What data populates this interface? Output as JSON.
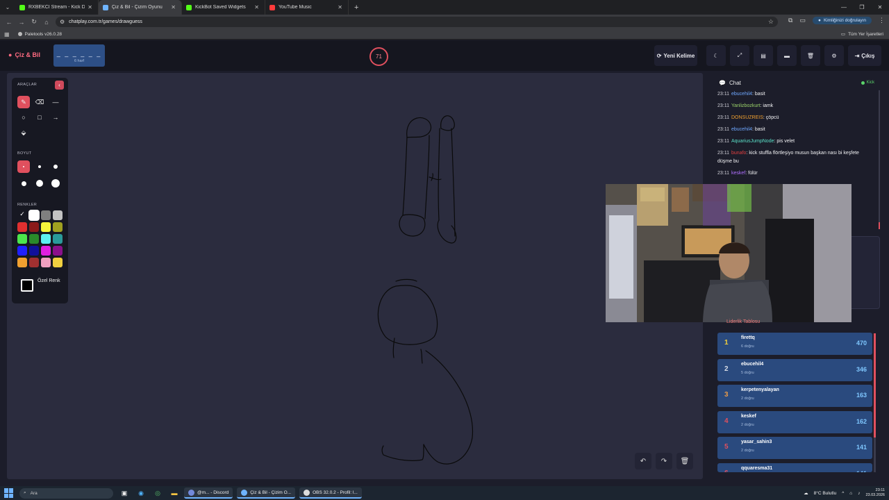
{
  "browser": {
    "tabs": [
      {
        "title": "RXBEKCI Stream - Kick Dashbo",
        "color": "#53fc18",
        "active": false
      },
      {
        "title": "Çiz & Bil - Çizim Oyunu",
        "color": "#6fb4ff",
        "active": true
      },
      {
        "title": "KickBot Saved Widgets",
        "color": "#53fc18",
        "active": false
      },
      {
        "title": "YouTube Music",
        "color": "#ff3b3b",
        "active": false
      }
    ],
    "url": "chatplay.com.tr/games/drawguess",
    "verify_label": "Kimliğinizi doğrulayın",
    "bookmark": "Paletools v26.0.28",
    "all_bookmarks": "Tüm Yer İşaretleri"
  },
  "header": {
    "logo": "Çiz & Bil",
    "word_mask": "_ _ _ _ _ _",
    "word_length": "6 harf",
    "timer": "71",
    "new_word": "Yeni Kelime",
    "exit": "Çıkış"
  },
  "tools": {
    "tools_label": "ARAÇLAR",
    "size_label": "BOYUT",
    "colors_label": "RENKLER",
    "custom_color": "Özel Renk",
    "palette": [
      "#000000",
      "#ffffff",
      "#7f7f7f",
      "#c3c3c3",
      "#e03030",
      "#8b1a1a",
      "#f5f53b",
      "#a0a020",
      "#4ce64c",
      "#2a8a2a",
      "#5cf0f0",
      "#2a9a9a",
      "#2020ff",
      "#10109a",
      "#e020e0",
      "#8a108a",
      "#f0a030",
      "#a03030",
      "#f0a0c0",
      "#f0d040"
    ]
  },
  "chat": {
    "title": "Chat",
    "source": "Kick",
    "messages": [
      {
        "time": "23:11",
        "user": "ebucehil4",
        "color": "#6fa8ff",
        "text": "basit"
      },
      {
        "time": "23:11",
        "user": "Yanlizbozkurt",
        "color": "#9bd36a",
        "text": "iamk"
      },
      {
        "time": "23:11",
        "user": "DONSUZREIS",
        "color": "#f0a030",
        "text": "çöpcü"
      },
      {
        "time": "23:11",
        "user": "ebucehil4",
        "color": "#6fa8ff",
        "text": "basit"
      },
      {
        "time": "23:11",
        "user": "AquariusJumpNode",
        "color": "#5be0c8",
        "text": "pis velet"
      },
      {
        "time": "23:11",
        "user": "bunafo",
        "color": "#e04040",
        "text": "kick stuffla flörtleşiyo musun başkan nası bi keşfete düşme bu"
      },
      {
        "time": "23:11",
        "user": "keskef",
        "color": "#b070ff",
        "text": "fülür"
      }
    ]
  },
  "leaderboard": {
    "title": "Liderlik Tablosu",
    "rows": [
      {
        "rank": "1",
        "name": "firettq",
        "sub": "6 doğru",
        "score": "470",
        "rank_color": "#f5d23b"
      },
      {
        "rank": "2",
        "name": "ebucehil4",
        "sub": "5 doğru",
        "score": "346",
        "rank_color": "#d8dde6"
      },
      {
        "rank": "3",
        "name": "kerpetenyalayan",
        "sub": "2 doğru",
        "score": "163",
        "rank_color": "#e89a4a"
      },
      {
        "rank": "4",
        "name": "keskef",
        "sub": "2 doğru",
        "score": "162",
        "rank_color": "#e0505e"
      },
      {
        "rank": "5",
        "name": "yasar_sahin3",
        "sub": "2 doğru",
        "score": "141",
        "rank_color": "#e0505e"
      },
      {
        "rank": "6",
        "name": "qquaresma31",
        "sub": "",
        "score": "141",
        "rank_color": "#e0505e"
      }
    ]
  },
  "taskbar": {
    "search": "Ara",
    "apps": [
      {
        "label": "@m... - Discord",
        "color": "#7289da"
      },
      {
        "label": "Çiz & Bil - Çizim O...",
        "color": "#6fb4ff"
      },
      {
        "label": "OBS 32.0.2 - Profil: l...",
        "color": "#dddddd"
      }
    ],
    "weather": "8°C Bulutlu",
    "time": "23:11",
    "date": "23.03.2026"
  }
}
